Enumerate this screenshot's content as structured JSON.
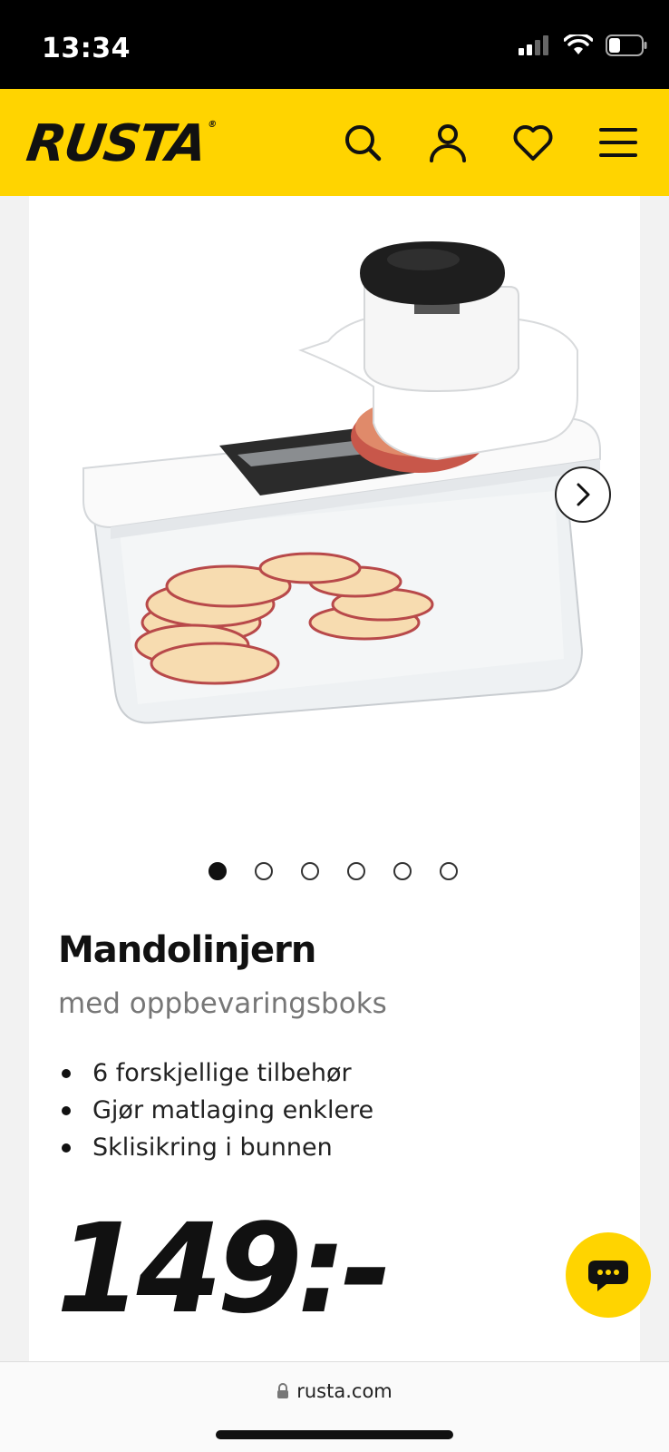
{
  "status_bar": {
    "time": "13:34"
  },
  "header": {
    "logo": "RUSTA",
    "logo_mark": "®",
    "icons": [
      "search-icon",
      "user-icon",
      "heart-icon",
      "menu-icon"
    ]
  },
  "gallery": {
    "image_count": 6,
    "active_index": 0,
    "next_icon": "chevron-right-icon"
  },
  "product": {
    "title": "Mandolinjern",
    "subtitle": "med oppbevaringsboks",
    "features": [
      "6 forskjellige tilbehør",
      "Gjør matlaging enklere",
      "Sklisikring i bunnen"
    ],
    "price": "149:-"
  },
  "browser": {
    "url": "rusta.com"
  },
  "colors": {
    "brand_yellow": "#ffd400",
    "text": "#111111",
    "muted": "#777777"
  }
}
